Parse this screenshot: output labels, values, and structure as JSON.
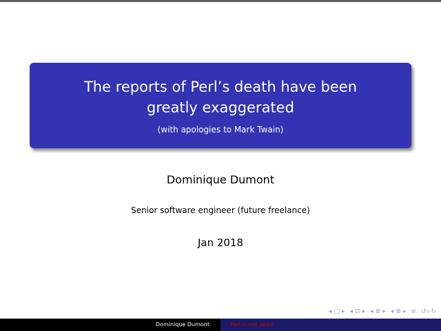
{
  "slide": {
    "title": "The reports of Perl’s death have been greatly exaggerated",
    "subtitle": "(with apologies to Mark Twain)",
    "author": "Dominique Dumont",
    "institute": "Senior software engineer (future freelance)",
    "date": "Jan 2018"
  },
  "footer": {
    "author": "Dominique Dumont",
    "short_title": "Perl is not dead"
  },
  "nav": {
    "frame_prev": "◂",
    "frame_icon": "□",
    "frame_next": "▸",
    "subsection_prev": "◂",
    "subsection_icon": "⊡",
    "subsection_next": "▸",
    "section_prev": "◂",
    "section_icon": "≣",
    "section_next": "▸",
    "doc_prev": "◂",
    "doc_icon": "≣",
    "doc_next": "▸",
    "appendix_icon": "≡",
    "search_icon": "↺⌕↻"
  },
  "colors": {
    "title_box": "#3333b3",
    "footer_left": "#000000",
    "footer_right": "#1a1a66",
    "footer_right_text": "#c00000"
  }
}
